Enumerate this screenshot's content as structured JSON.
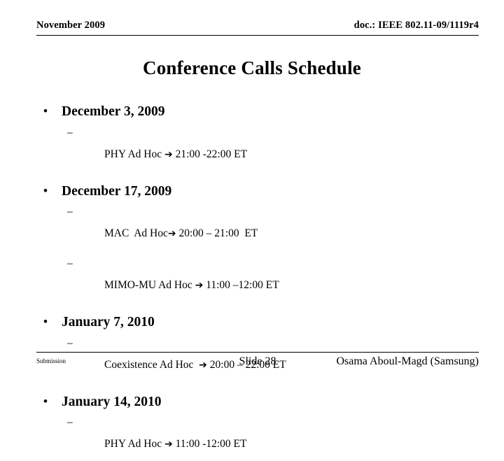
{
  "header": {
    "date": "November 2009",
    "doc": "doc.: IEEE 802.11-09/1119r4"
  },
  "title": "Conference Calls Schedule",
  "arrow_glyph": "➔",
  "bullet_glyph": "•",
  "dash_glyph": "–",
  "groups": [
    {
      "date": "December 3, 2009",
      "items": [
        {
          "name": "PHY Ad Hoc ",
          "time": " 21:00 -22:00 ET"
        }
      ]
    },
    {
      "date": "December 17, 2009",
      "items": [
        {
          "name": "MAC  Ad Hoc",
          "time": " 20:00 – 21:00  ET"
        },
        {
          "name": "MIMO-MU Ad Hoc ",
          "time": " 11:00 –12:00 ET"
        }
      ]
    },
    {
      "date": "January 7, 2010",
      "items": [
        {
          "name": "Coexistence Ad Hoc  ",
          "time": " 20:00 – 22:00 ET"
        }
      ]
    },
    {
      "date": "January 14, 2010",
      "items": [
        {
          "name": "PHY Ad Hoc ",
          "time": " 11:00 -12:00 ET"
        }
      ]
    }
  ],
  "footer": {
    "submission": "Submission",
    "slide": "Slide 28",
    "author": "Osama Aboul-Magd (Samsung)"
  }
}
